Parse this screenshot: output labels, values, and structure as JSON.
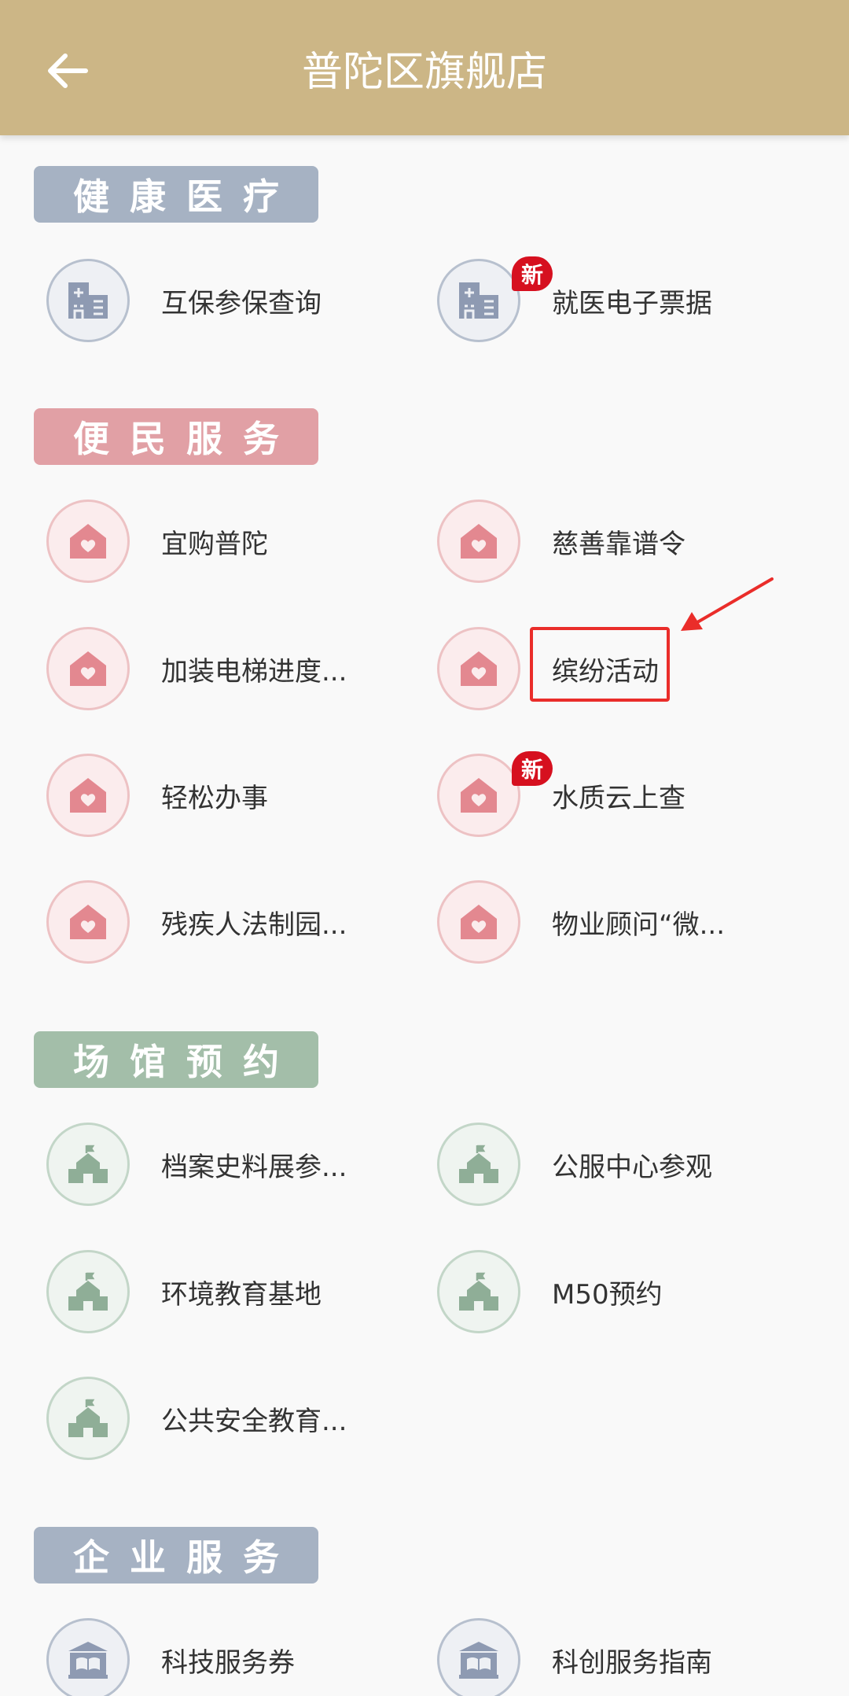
{
  "header": {
    "title": "普陀区旗舰店",
    "back_icon": "back-arrow-icon",
    "background": "#ccb686"
  },
  "sections": [
    {
      "title": "健康医疗",
      "color": "#a6b2c3",
      "items": [
        {
          "label": "互保参保查询",
          "icon": "hospital-icon",
          "badge": ""
        },
        {
          "label": "就医电子票据",
          "icon": "hospital-icon",
          "badge": "新"
        }
      ]
    },
    {
      "title": "便民服务",
      "color": "#e1a0a5",
      "items": [
        {
          "label": "宜购普陀",
          "icon": "house-heart-icon",
          "badge": ""
        },
        {
          "label": "慈善靠谱令",
          "icon": "house-heart-icon",
          "badge": ""
        },
        {
          "label": "加装电梯进度...",
          "icon": "house-heart-icon",
          "badge": ""
        },
        {
          "label": "缤纷活动",
          "icon": "house-heart-icon",
          "badge": ""
        },
        {
          "label": "轻松办事",
          "icon": "house-heart-icon",
          "badge": ""
        },
        {
          "label": "水质云上查",
          "icon": "house-heart-icon",
          "badge": "新"
        },
        {
          "label": "残疾人法制园...",
          "icon": "house-heart-icon",
          "badge": ""
        },
        {
          "label": "物业顾问“微...",
          "icon": "house-heart-icon",
          "badge": ""
        }
      ]
    },
    {
      "title": "场馆预约",
      "color": "#a3bea9",
      "items": [
        {
          "label": "档案史料展参...",
          "icon": "venue-icon",
          "badge": ""
        },
        {
          "label": "公服中心参观",
          "icon": "venue-icon",
          "badge": ""
        },
        {
          "label": "环境教育基地",
          "icon": "venue-icon",
          "badge": ""
        },
        {
          "label": "M50预约",
          "icon": "venue-icon",
          "badge": ""
        },
        {
          "label": "公共安全教育...",
          "icon": "venue-icon",
          "badge": ""
        }
      ]
    },
    {
      "title": "企业服务",
      "color": "#a6b2c3",
      "items": [
        {
          "label": "科技服务券",
          "icon": "library-icon",
          "badge": ""
        },
        {
          "label": "科创服务指南",
          "icon": "library-icon",
          "badge": ""
        }
      ]
    }
  ],
  "annotation": {
    "color": "#ea2d2a",
    "highlight_target": "缤纷活动"
  }
}
